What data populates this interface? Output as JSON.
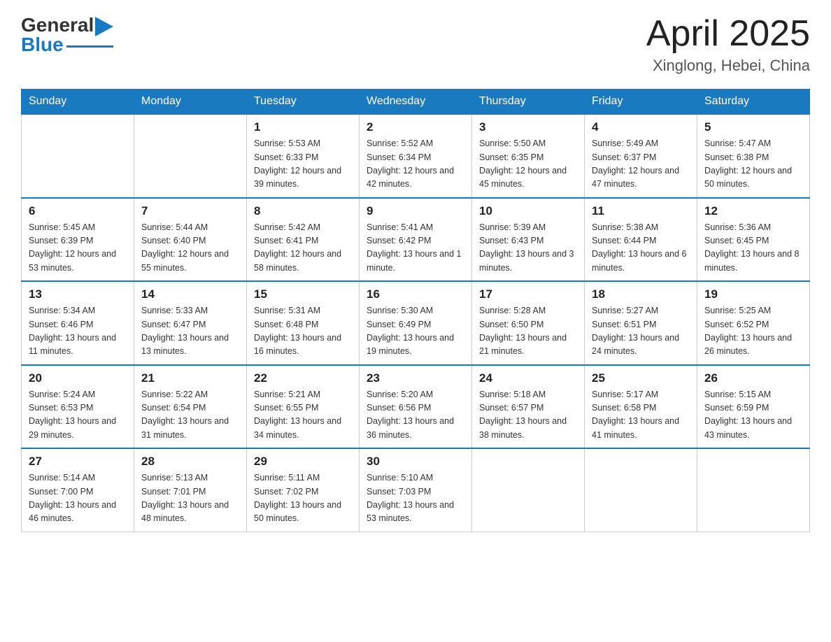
{
  "header": {
    "logo_general": "General",
    "logo_blue": "Blue",
    "month_title": "April 2025",
    "location": "Xinglong, Hebei, China"
  },
  "days_of_week": [
    "Sunday",
    "Monday",
    "Tuesday",
    "Wednesday",
    "Thursday",
    "Friday",
    "Saturday"
  ],
  "weeks": [
    [
      {
        "day": "",
        "info": ""
      },
      {
        "day": "",
        "info": ""
      },
      {
        "day": "1",
        "info": "Sunrise: 5:53 AM\nSunset: 6:33 PM\nDaylight: 12 hours\nand 39 minutes."
      },
      {
        "day": "2",
        "info": "Sunrise: 5:52 AM\nSunset: 6:34 PM\nDaylight: 12 hours\nand 42 minutes."
      },
      {
        "day": "3",
        "info": "Sunrise: 5:50 AM\nSunset: 6:35 PM\nDaylight: 12 hours\nand 45 minutes."
      },
      {
        "day": "4",
        "info": "Sunrise: 5:49 AM\nSunset: 6:37 PM\nDaylight: 12 hours\nand 47 minutes."
      },
      {
        "day": "5",
        "info": "Sunrise: 5:47 AM\nSunset: 6:38 PM\nDaylight: 12 hours\nand 50 minutes."
      }
    ],
    [
      {
        "day": "6",
        "info": "Sunrise: 5:45 AM\nSunset: 6:39 PM\nDaylight: 12 hours\nand 53 minutes."
      },
      {
        "day": "7",
        "info": "Sunrise: 5:44 AM\nSunset: 6:40 PM\nDaylight: 12 hours\nand 55 minutes."
      },
      {
        "day": "8",
        "info": "Sunrise: 5:42 AM\nSunset: 6:41 PM\nDaylight: 12 hours\nand 58 minutes."
      },
      {
        "day": "9",
        "info": "Sunrise: 5:41 AM\nSunset: 6:42 PM\nDaylight: 13 hours\nand 1 minute."
      },
      {
        "day": "10",
        "info": "Sunrise: 5:39 AM\nSunset: 6:43 PM\nDaylight: 13 hours\nand 3 minutes."
      },
      {
        "day": "11",
        "info": "Sunrise: 5:38 AM\nSunset: 6:44 PM\nDaylight: 13 hours\nand 6 minutes."
      },
      {
        "day": "12",
        "info": "Sunrise: 5:36 AM\nSunset: 6:45 PM\nDaylight: 13 hours\nand 8 minutes."
      }
    ],
    [
      {
        "day": "13",
        "info": "Sunrise: 5:34 AM\nSunset: 6:46 PM\nDaylight: 13 hours\nand 11 minutes."
      },
      {
        "day": "14",
        "info": "Sunrise: 5:33 AM\nSunset: 6:47 PM\nDaylight: 13 hours\nand 13 minutes."
      },
      {
        "day": "15",
        "info": "Sunrise: 5:31 AM\nSunset: 6:48 PM\nDaylight: 13 hours\nand 16 minutes."
      },
      {
        "day": "16",
        "info": "Sunrise: 5:30 AM\nSunset: 6:49 PM\nDaylight: 13 hours\nand 19 minutes."
      },
      {
        "day": "17",
        "info": "Sunrise: 5:28 AM\nSunset: 6:50 PM\nDaylight: 13 hours\nand 21 minutes."
      },
      {
        "day": "18",
        "info": "Sunrise: 5:27 AM\nSunset: 6:51 PM\nDaylight: 13 hours\nand 24 minutes."
      },
      {
        "day": "19",
        "info": "Sunrise: 5:25 AM\nSunset: 6:52 PM\nDaylight: 13 hours\nand 26 minutes."
      }
    ],
    [
      {
        "day": "20",
        "info": "Sunrise: 5:24 AM\nSunset: 6:53 PM\nDaylight: 13 hours\nand 29 minutes."
      },
      {
        "day": "21",
        "info": "Sunrise: 5:22 AM\nSunset: 6:54 PM\nDaylight: 13 hours\nand 31 minutes."
      },
      {
        "day": "22",
        "info": "Sunrise: 5:21 AM\nSunset: 6:55 PM\nDaylight: 13 hours\nand 34 minutes."
      },
      {
        "day": "23",
        "info": "Sunrise: 5:20 AM\nSunset: 6:56 PM\nDaylight: 13 hours\nand 36 minutes."
      },
      {
        "day": "24",
        "info": "Sunrise: 5:18 AM\nSunset: 6:57 PM\nDaylight: 13 hours\nand 38 minutes."
      },
      {
        "day": "25",
        "info": "Sunrise: 5:17 AM\nSunset: 6:58 PM\nDaylight: 13 hours\nand 41 minutes."
      },
      {
        "day": "26",
        "info": "Sunrise: 5:15 AM\nSunset: 6:59 PM\nDaylight: 13 hours\nand 43 minutes."
      }
    ],
    [
      {
        "day": "27",
        "info": "Sunrise: 5:14 AM\nSunset: 7:00 PM\nDaylight: 13 hours\nand 46 minutes."
      },
      {
        "day": "28",
        "info": "Sunrise: 5:13 AM\nSunset: 7:01 PM\nDaylight: 13 hours\nand 48 minutes."
      },
      {
        "day": "29",
        "info": "Sunrise: 5:11 AM\nSunset: 7:02 PM\nDaylight: 13 hours\nand 50 minutes."
      },
      {
        "day": "30",
        "info": "Sunrise: 5:10 AM\nSunset: 7:03 PM\nDaylight: 13 hours\nand 53 minutes."
      },
      {
        "day": "",
        "info": ""
      },
      {
        "day": "",
        "info": ""
      },
      {
        "day": "",
        "info": ""
      }
    ]
  ],
  "colors": {
    "header_bg": "#1a7abf",
    "header_text": "#ffffff",
    "border_top": "#1a7abf",
    "cell_border": "#cccccc"
  }
}
